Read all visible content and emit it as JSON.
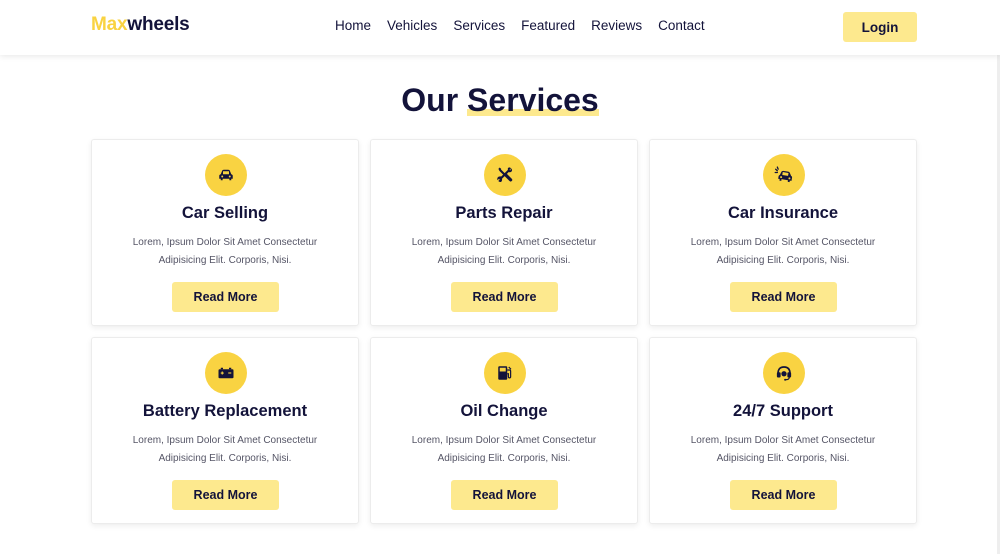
{
  "header": {
    "logo_accent": "Max",
    "logo_rest": "wheels",
    "nav": [
      "Home",
      "Vehicles",
      "Services",
      "Featured",
      "Reviews",
      "Contact"
    ],
    "login_label": "Login"
  },
  "section": {
    "title_plain": "Our",
    "title_highlight": "Services"
  },
  "services": [
    {
      "title": "Car Selling",
      "text": "Lorem, Ipsum Dolor Sit Amet Consectetur Adipisicing Elit. Corporis, Nisi.",
      "button": "Read More",
      "icon": "car-icon"
    },
    {
      "title": "Parts Repair",
      "text": "Lorem, Ipsum Dolor Sit Amet Consectetur Adipisicing Elit. Corporis, Nisi.",
      "button": "Read More",
      "icon": "tools-icon"
    },
    {
      "title": "Car Insurance",
      "text": "Lorem, Ipsum Dolor Sit Amet Consectetur Adipisicing Elit. Corporis, Nisi.",
      "button": "Read More",
      "icon": "car-crash-icon"
    },
    {
      "title": "Battery Replacement",
      "text": "Lorem, Ipsum Dolor Sit Amet Consectetur Adipisicing Elit. Corporis, Nisi.",
      "button": "Read More",
      "icon": "battery-icon"
    },
    {
      "title": "Oil Change",
      "text": "Lorem, Ipsum Dolor Sit Amet Consectetur Adipisicing Elit. Corporis, Nisi.",
      "button": "Read More",
      "icon": "gas-pump-icon"
    },
    {
      "title": "24/7 Support",
      "text": "Lorem, Ipsum Dolor Sit Amet Consectetur Adipisicing Elit. Corporis, Nisi.",
      "button": "Read More",
      "icon": "headset-icon"
    }
  ],
  "colors": {
    "accent": "#f9d342",
    "accent_light": "#fde98e",
    "text_dark": "#13133a"
  }
}
